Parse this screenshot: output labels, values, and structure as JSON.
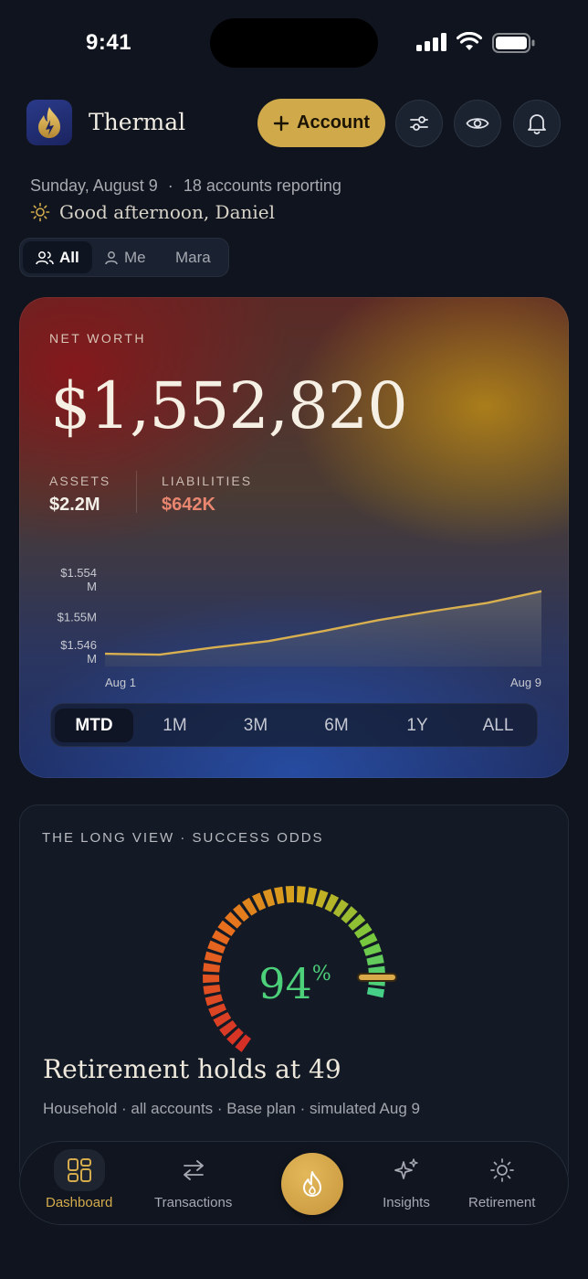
{
  "status_bar": {
    "time": "9:41"
  },
  "header": {
    "app_name": "Thermal",
    "account_button": "Account"
  },
  "greeting": {
    "date": "Sunday, August 9",
    "separator": "·",
    "accounts_reporting": "18 accounts reporting",
    "message": "Good afternoon, Daniel"
  },
  "filter_tabs": [
    {
      "label": "All",
      "active": true
    },
    {
      "label": "Me",
      "active": false
    },
    {
      "label": "Mara",
      "active": false
    }
  ],
  "net_worth": {
    "label": "NET WORTH",
    "value": "$1,552,820",
    "assets_label": "ASSETS",
    "assets_value": "$2.2M",
    "liabilities_label": "LIABILITIES",
    "liabilities_value": "$642K",
    "liabilities_color": "#e8866f",
    "line_color": "#d9b050"
  },
  "chart_data": {
    "type": "area",
    "x": [
      "Aug 1",
      "Aug 2",
      "Aug 3",
      "Aug 4",
      "Aug 5",
      "Aug 6",
      "Aug 7",
      "Aug 8",
      "Aug 9"
    ],
    "x_tick_labels": [
      "Aug 1",
      "Aug 9"
    ],
    "y_tick_labels": [
      [
        "$1.554",
        "M"
      ],
      [
        "$1.55M"
      ],
      [
        "$1.546",
        "M"
      ]
    ],
    "y_ticks": [
      1.554,
      1.55,
      1.546
    ],
    "series": [
      {
        "values": [
          1.5459,
          1.5458,
          1.5466,
          1.5473,
          1.5484,
          1.5496,
          1.5506,
          1.5515,
          1.5528
        ]
      }
    ],
    "ylim": [
      1.5445,
      1.556
    ]
  },
  "range_tabs": [
    {
      "label": "MTD",
      "active": true
    },
    {
      "label": "1M",
      "active": false
    },
    {
      "label": "3M",
      "active": false
    },
    {
      "label": "6M",
      "active": false
    },
    {
      "label": "1Y",
      "active": false
    },
    {
      "label": "ALL",
      "active": false
    }
  ],
  "long_view": {
    "label": "THE LONG VIEW · SUCCESS ODDS",
    "odds_value": "94",
    "odds_unit": "%",
    "odds_fraction": 0.94,
    "odds_color": "#4cd07a",
    "title": "Retirement holds at 49",
    "subtitle": "Household · all accounts · Base plan · simulated Aug 9"
  },
  "bottom_nav": [
    {
      "label": "Dashboard",
      "icon": "dashboard-icon",
      "active": true
    },
    {
      "label": "Transactions",
      "icon": "transfer-arrows-icon",
      "active": false
    },
    {
      "label": "Insights",
      "icon": "sparkles-icon",
      "active": false
    },
    {
      "label": "Retirement",
      "icon": "sun-icon",
      "active": false
    }
  ],
  "colors": {
    "accent_gold": "#cfa94a",
    "background": "#0f141e"
  }
}
